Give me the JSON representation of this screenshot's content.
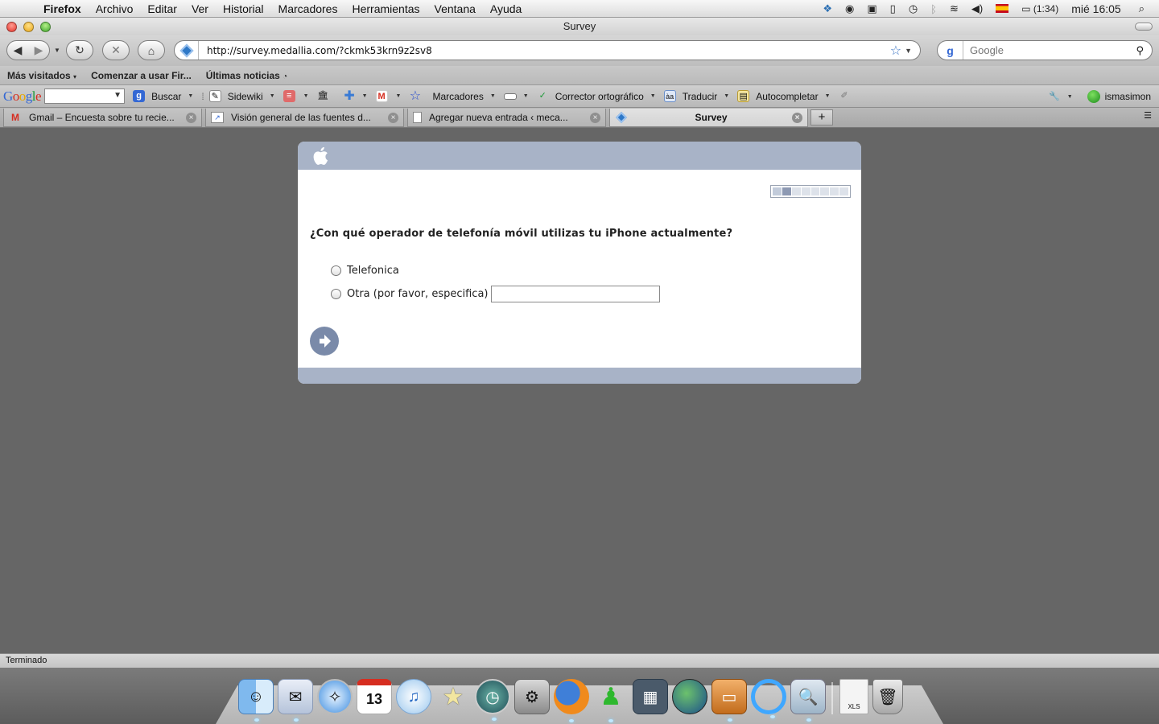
{
  "menubar": {
    "app": "Firefox",
    "items": [
      "Archivo",
      "Editar",
      "Ver",
      "Historial",
      "Marcadores",
      "Herramientas",
      "Ventana",
      "Ayuda"
    ],
    "battery": "(1:34)",
    "clock": "mié 16:05"
  },
  "window": {
    "title": "Survey"
  },
  "navbar": {
    "url": "http://survey.medallia.com/?ckmk53krn9z2sv8",
    "search_placeholder": "Google"
  },
  "bookmarks": [
    "Más visitados",
    "Comenzar a usar Fir...",
    "Últimas noticias"
  ],
  "google_toolbar": {
    "search": "Buscar",
    "sidewiki": "Sidewiki",
    "bookmarks": "Marcadores",
    "spellcheck": "Corrector ortográfico",
    "translate": "Traducir",
    "autofill": "Autocompletar",
    "user": "ismasimon"
  },
  "tabs": [
    {
      "label": "Gmail – Encuesta sobre tu recie...",
      "active": false
    },
    {
      "label": "Visión general de las fuentes d...",
      "active": false
    },
    {
      "label": "Agregar nueva entrada ‹ meca...",
      "active": false
    },
    {
      "label": "Survey",
      "active": true
    }
  ],
  "survey": {
    "question": "¿Con qué operador de telefonía móvil utilizas tu iPhone actualmente?",
    "options": [
      "Telefonica",
      "Otra (por favor, especifica)"
    ],
    "other_value": "",
    "progress": {
      "current": 2,
      "total": 8
    }
  },
  "status": "Terminado",
  "dock": [
    "Finder",
    "Mail",
    "Safari",
    "iCal",
    "iTunes",
    "iMovie",
    "Time Machine",
    "System Preferences",
    "Firefox",
    "Adium",
    "Dashboard",
    "Google Earth",
    "Keynote",
    "iChat",
    "Preview",
    "XLS document",
    "Trash"
  ]
}
